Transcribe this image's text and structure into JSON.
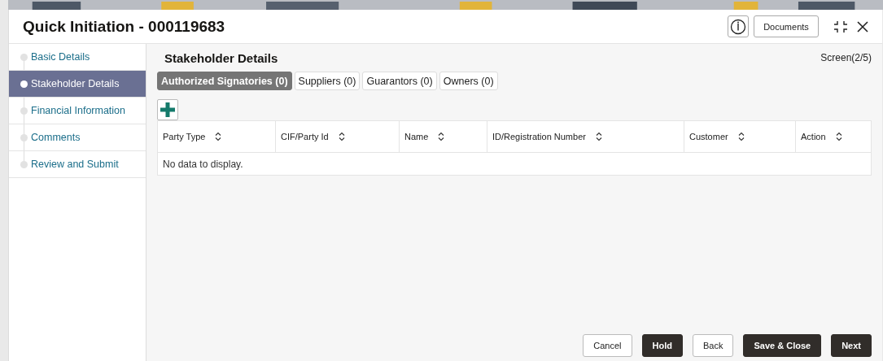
{
  "window": {
    "title": "Quick Initiation - 000119683",
    "documents_button": "Documents"
  },
  "sidebar": {
    "items": [
      {
        "label": "Basic Details",
        "selected": false
      },
      {
        "label": "Stakeholder Details",
        "selected": true
      },
      {
        "label": "Financial Information",
        "selected": false
      },
      {
        "label": "Comments",
        "selected": false
      },
      {
        "label": "Review and Submit",
        "selected": false
      }
    ]
  },
  "section": {
    "title": "Stakeholder Details",
    "screen": "Screen(2/5)"
  },
  "tabs": [
    {
      "label": "Authorized Signatories (0)",
      "selected": true
    },
    {
      "label": "Suppliers (0)",
      "selected": false
    },
    {
      "label": "Guarantors (0)",
      "selected": false
    },
    {
      "label": "Owners (0)",
      "selected": false
    }
  ],
  "table": {
    "columns": [
      "Party Type",
      "CIF/Party Id",
      "Name",
      "ID/Registration Number",
      "Customer",
      "Action"
    ],
    "empty_message": "No data to display."
  },
  "buttons": [
    {
      "label": "Cancel",
      "kind": "secondary"
    },
    {
      "label": "Hold",
      "kind": "primary"
    },
    {
      "label": "Back",
      "kind": "secondary"
    },
    {
      "label": "Save & Close",
      "kind": "primary"
    },
    {
      "label": "Next",
      "kind": "primary"
    }
  ]
}
